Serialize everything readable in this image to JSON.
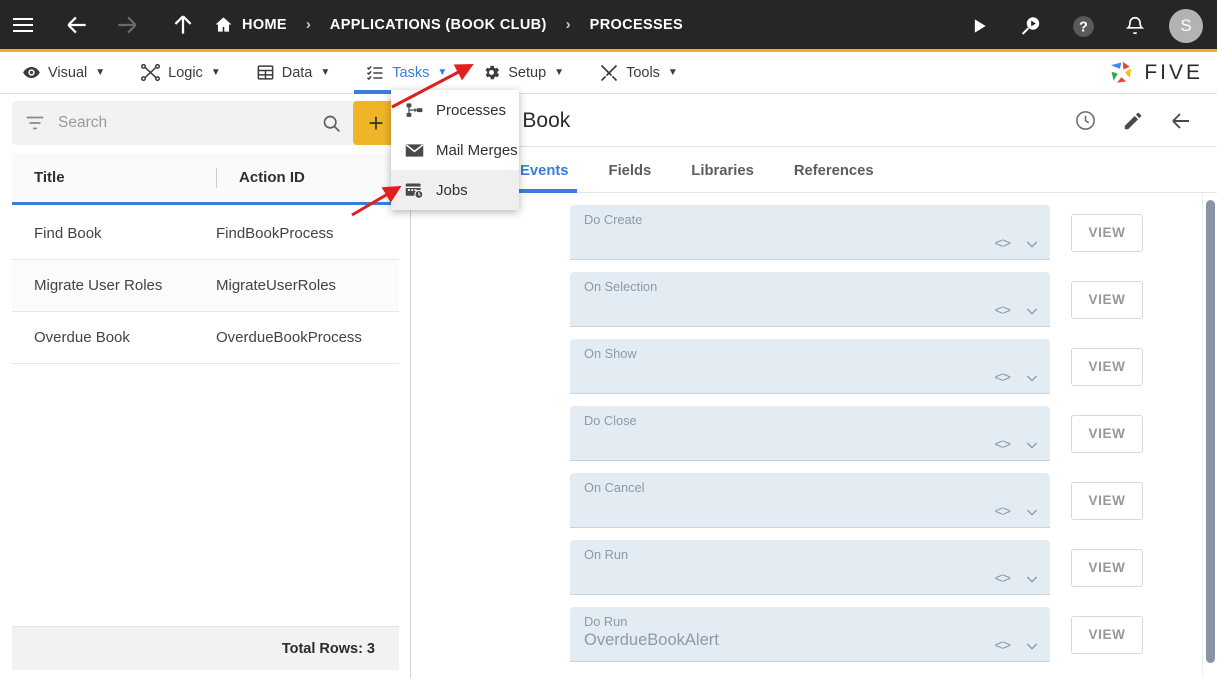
{
  "topbar": {
    "menu_icon": "hamburger-icon",
    "back_icon": "arrow-left-icon",
    "forward_icon": "arrow-right-icon",
    "up_icon": "arrow-up-icon",
    "breadcrumbs": [
      {
        "label": "HOME",
        "icon": "home-icon"
      },
      {
        "label": "APPLICATIONS (BOOK CLUB)"
      },
      {
        "label": "PROCESSES"
      }
    ],
    "separator": "›",
    "actions": [
      {
        "name": "run-icon"
      },
      {
        "name": "search-run-icon"
      },
      {
        "name": "help-icon"
      },
      {
        "name": "notifications-icon"
      }
    ],
    "avatar_initial": "S",
    "accent_color": "#f0ab2e"
  },
  "menubar": {
    "items": [
      {
        "label": "Visual",
        "icon": "eye-icon",
        "active": false
      },
      {
        "label": "Logic",
        "icon": "logic-nodes-icon",
        "active": false
      },
      {
        "label": "Data",
        "icon": "table-grid-icon",
        "active": false
      },
      {
        "label": "Tasks",
        "icon": "tasks-list-icon",
        "active": true
      },
      {
        "label": "Setup",
        "icon": "gear-icon",
        "active": false
      },
      {
        "label": "Tools",
        "icon": "tools-icon",
        "active": false
      }
    ],
    "caret": "▼",
    "brand": "FIVE",
    "active_color": "#3b7ddd"
  },
  "dropdown": {
    "items": [
      {
        "label": "Processes",
        "icon": "process-flow-icon",
        "hover": false
      },
      {
        "label": "Mail Merges",
        "icon": "envelope-icon",
        "hover": false
      },
      {
        "label": "Jobs",
        "icon": "calendar-clock-icon",
        "hover": true
      }
    ]
  },
  "left_panel": {
    "search": {
      "placeholder": "Search",
      "value": "",
      "filter_icon": "filter-icon",
      "search_icon": "magnifier-icon"
    },
    "add_button": {
      "label": "+",
      "name": "add-record-button",
      "color": "#f0b429"
    },
    "grid": {
      "columns": [
        "Title",
        "Action ID"
      ],
      "rows": [
        {
          "title": "Find Book",
          "action_id": "FindBookProcess"
        },
        {
          "title": "Migrate User Roles",
          "action_id": "MigrateUserRoles"
        },
        {
          "title": "Overdue Book",
          "action_id": "OverdueBookProcess"
        }
      ]
    },
    "footer": {
      "total_rows_label": "Total Rows: 3"
    }
  },
  "right_panel": {
    "title": "Overdue Book",
    "header_actions": [
      {
        "name": "history-clock-icon"
      },
      {
        "name": "edit-pencil-icon"
      },
      {
        "name": "back-arrow-icon"
      }
    ],
    "tabs": [
      {
        "label": "Events",
        "active": true
      },
      {
        "label": "Fields",
        "active": false
      },
      {
        "label": "Libraries",
        "active": false
      },
      {
        "label": "References",
        "active": false
      }
    ],
    "events": [
      {
        "label": "Do Create",
        "value": "",
        "view": "VIEW"
      },
      {
        "label": "On Selection",
        "value": "",
        "view": "VIEW"
      },
      {
        "label": "On Show",
        "value": "",
        "view": "VIEW"
      },
      {
        "label": "Do Close",
        "value": "",
        "view": "VIEW"
      },
      {
        "label": "On Cancel",
        "value": "",
        "view": "VIEW"
      },
      {
        "label": "On Run",
        "value": "",
        "view": "VIEW"
      },
      {
        "label": "Do Run",
        "value": "OverdueBookAlert",
        "view": "VIEW"
      }
    ],
    "code_icon": "code-brackets-icon",
    "expand_icon": "chevron-down-icon"
  }
}
